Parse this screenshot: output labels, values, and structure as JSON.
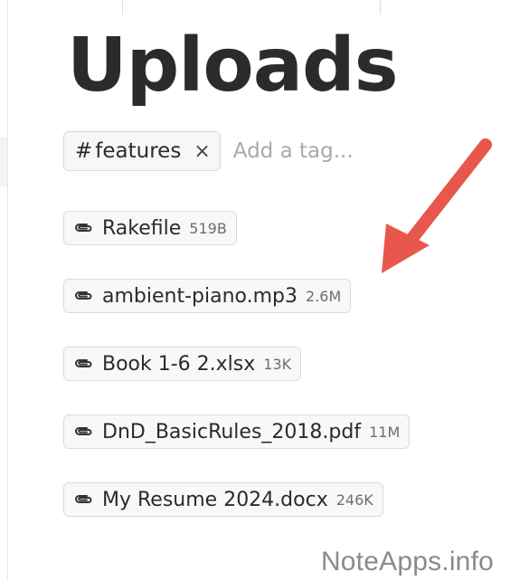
{
  "page": {
    "title": "Uploads"
  },
  "tags": {
    "active": [
      {
        "hash": "#",
        "label": "features",
        "remove": "×"
      }
    ],
    "input_placeholder": "Add a tag..."
  },
  "attachments": [
    {
      "name": "Rakefile",
      "size": "519B",
      "icon": "paperclip-icon"
    },
    {
      "name": "ambient-piano.mp3",
      "size": "2.6M",
      "icon": "paperclip-icon"
    },
    {
      "name": "Book 1-6 2.xlsx",
      "size": "13K",
      "icon": "paperclip-icon"
    },
    {
      "name": "DnD_BasicRules_2018.pdf",
      "size": "11M",
      "icon": "paperclip-icon"
    },
    {
      "name": "My Resume 2024.docx",
      "size": "246K",
      "icon": "paperclip-icon"
    }
  ],
  "annotation": {
    "arrow_color": "#e8574b",
    "points_to": "ambient-piano.mp3"
  },
  "watermark": "NoteApps.info",
  "colors": {
    "text": "#2b2b2b",
    "muted": "#6e6e6e",
    "chip_bg": "#f8f8f8",
    "chip_border": "#dadada"
  }
}
